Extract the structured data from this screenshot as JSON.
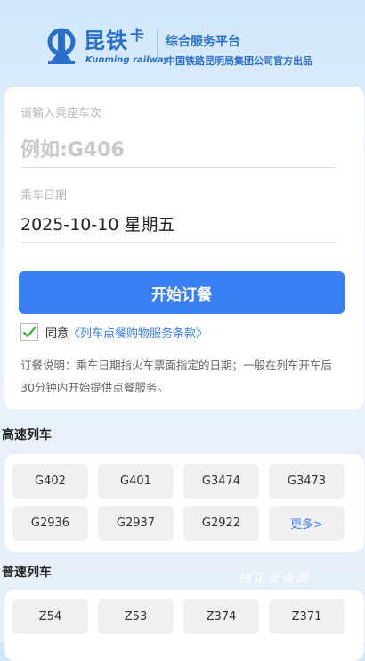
{
  "header": {
    "brand_name": "昆铁",
    "brand_suffix": "卡",
    "brand_english": "Kunming railway",
    "tagline": "综合服务平台",
    "tagline_sub": "中国铁路昆明局集团公司官方出品",
    "brand_color": "#2a6fc9"
  },
  "form": {
    "train_label": "请输入乘座车次",
    "train_placeholder": "例如:G406",
    "train_value": "",
    "date_label": "乘车日期",
    "date_value": "2025-10-10 星期五",
    "submit_label": "开始订餐",
    "agree_checked": true,
    "agree_text": "同意",
    "agree_link": "《列车点餐购物服务条款》",
    "note": "订餐说明：乘车日期指火车票面指定的日期；一般在列车开车后30分钟内开始提供点餐服务。",
    "accent_color": "#3b7ff5"
  },
  "high_speed": {
    "title": "高速列车",
    "trains": [
      "G402",
      "G401",
      "G3474",
      "G3473",
      "G2936",
      "G2937",
      "G2922"
    ],
    "more_label": "更多>"
  },
  "normal": {
    "title": "普速列车",
    "trains": [
      "Z54",
      "Z53",
      "Z374",
      "Z371"
    ]
  },
  "watermark": "梅花安卓网"
}
